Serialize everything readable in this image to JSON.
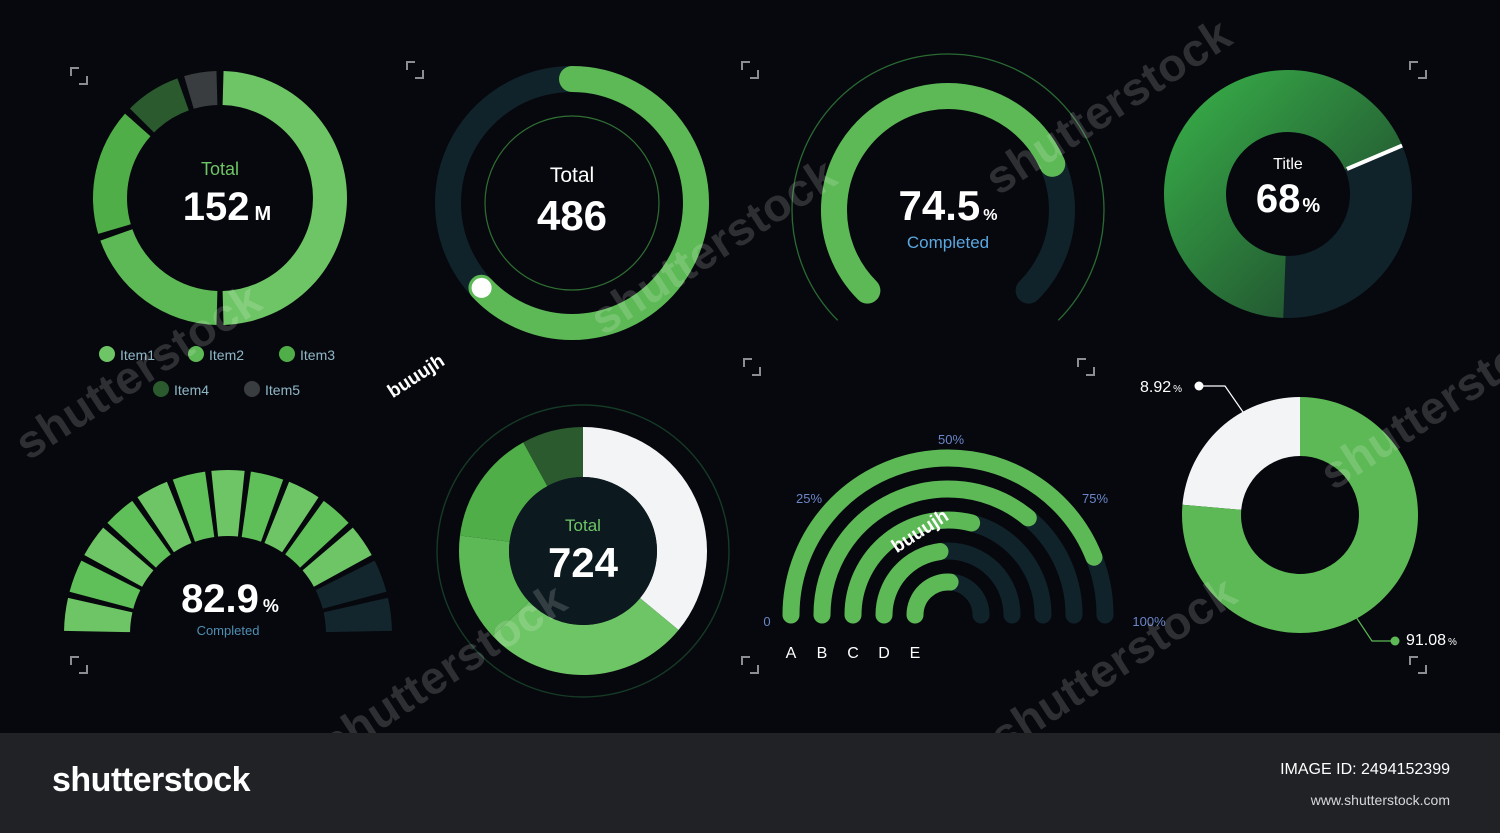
{
  "theme": {
    "background": "#07080d",
    "green_light": "#6ec565",
    "green": "#5db955",
    "green_mid": "#4fae48",
    "green_dark": "#3a8a38",
    "green_deep": "#2a5a2e",
    "gray": "#3a3d40",
    "track": "#10232a",
    "white": "#f2f4f5",
    "label_blue": "#5ba7e0"
  },
  "chart_data": [
    {
      "type": "pie",
      "style": "segmented-donut",
      "center_label": "Total",
      "value_text": "152",
      "unit": "M",
      "legend_placement": "bottom",
      "series": [
        {
          "name": "Item1",
          "value": 50,
          "color": "#6ec565"
        },
        {
          "name": "Item2",
          "value": 20,
          "color": "#5db955"
        },
        {
          "name": "Item3",
          "value": 17,
          "color": "#4fae48"
        },
        {
          "name": "Item4",
          "value": 8,
          "color": "#2a5a2e"
        },
        {
          "name": "Item5",
          "value": 5,
          "color": "#3a3d40"
        }
      ]
    },
    {
      "type": "pie",
      "style": "progress-ring",
      "center_label": "Total",
      "value_text": "486",
      "progress": 0.63
    },
    {
      "type": "pie",
      "style": "progress-arc",
      "value_text": "74.5",
      "unit": "%",
      "status": "Completed",
      "value": 74.5
    },
    {
      "type": "pie",
      "style": "donut",
      "center_label": "Title",
      "value_text": "68",
      "unit": "%",
      "value": 68
    },
    {
      "type": "bar",
      "style": "segmented-gauge",
      "value_text": "82.9",
      "unit": "%",
      "status": "Completed",
      "segments_total": 13,
      "segments_filled": 11,
      "value": 82.9
    },
    {
      "type": "pie",
      "style": "donut",
      "center_label": "Total",
      "value_text": "724",
      "slices": [
        {
          "value": 36,
          "color": "#f2f4f5"
        },
        {
          "value": 27,
          "color": "#6ec565"
        },
        {
          "value": 14,
          "color": "#5db955"
        },
        {
          "value": 15,
          "color": "#4fae48"
        },
        {
          "value": 8,
          "color": "#2a5a2e"
        }
      ]
    },
    {
      "type": "bar",
      "style": "concentric-semicircle",
      "scale_labels": [
        "0",
        "25%",
        "50%",
        "75%",
        "100%"
      ],
      "categories": [
        "A",
        "B",
        "C",
        "D",
        "E"
      ],
      "values": [
        88,
        72,
        58,
        46,
        52
      ]
    },
    {
      "type": "pie",
      "style": "donut",
      "slices": [
        {
          "label": "8.92",
          "unit": "%",
          "value": 8.92,
          "color": "#f2f4f5"
        },
        {
          "label": "91.08",
          "unit": "%",
          "value": 91.08,
          "color": "#5db955"
        }
      ]
    }
  ],
  "watermarks": [
    "shutterstock",
    "shutterstock",
    "shutterstock",
    "shutterstock",
    "shutterstock",
    "shutterstock"
  ],
  "tags": [
    "buuujh",
    "buuujh"
  ],
  "footer": {
    "logo": "shutterstock",
    "image_id": "IMAGE ID: 2494152399",
    "site": "www.shutterstock.com"
  }
}
